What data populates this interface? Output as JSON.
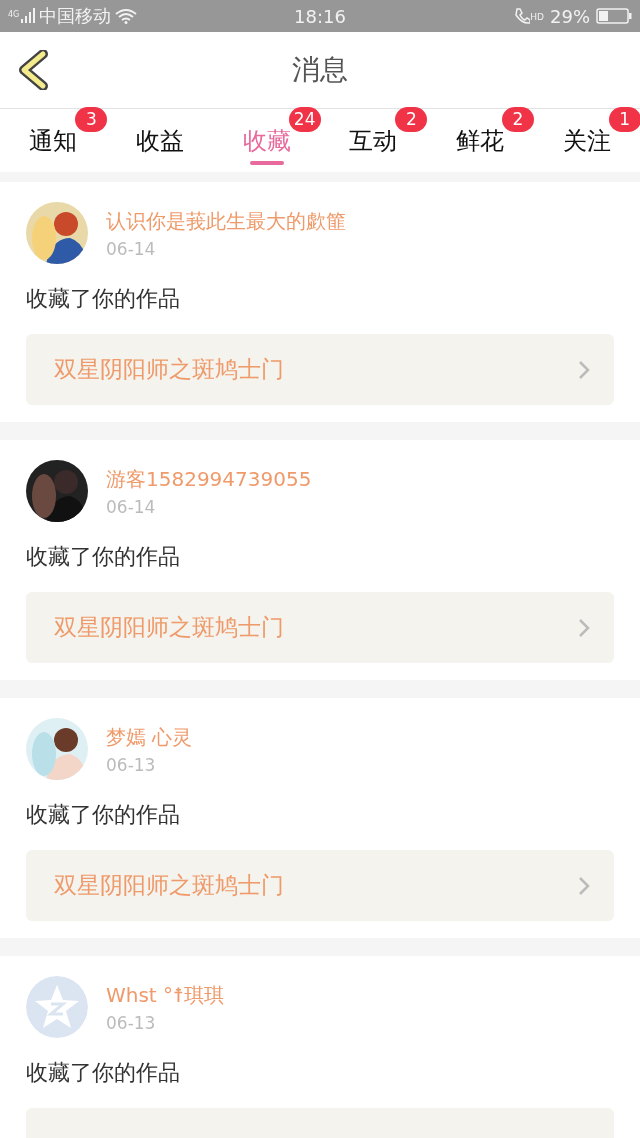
{
  "status_bar": {
    "network": "4G",
    "carrier": "中国移动",
    "time": "18:16",
    "call_badge": "HD",
    "battery": "29%"
  },
  "header": {
    "title": "消息"
  },
  "tabs": [
    {
      "label": "通知",
      "badge": "3",
      "selected": false
    },
    {
      "label": "收益",
      "selected": false
    },
    {
      "label": "收藏",
      "badge": "24",
      "selected": true
    },
    {
      "label": "互动",
      "badge": "2",
      "selected": false
    },
    {
      "label": "鲜花",
      "badge": "2",
      "selected": false
    },
    {
      "label": "关注",
      "badge": "1",
      "selected": false
    }
  ],
  "messages": [
    {
      "name": "认识你是莪此生最大的歔篚",
      "date": "06-14",
      "text": "收藏了你的作品",
      "work": "双星阴阳师之斑鸠士门"
    },
    {
      "name": "游客1582994739055",
      "date": "06-14",
      "text": "收藏了你的作品",
      "work": "双星阴阳师之斑鸠士门"
    },
    {
      "name": "梦嫣 心灵",
      "date": "06-13",
      "text": "收藏了你的作品",
      "work": "双星阴阳师之斑鸠士门"
    },
    {
      "avatar": {
        "kind": "default"
      },
      "name": "Whst °☨琪琪",
      "date": "06-13",
      "text": "收藏了你的作品"
    }
  ]
}
